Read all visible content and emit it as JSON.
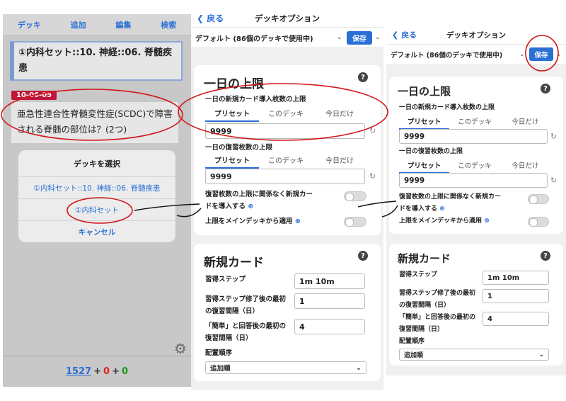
{
  "panel_review": {
    "toolbar": [
      "デッキ",
      "追加",
      "編集",
      "検索"
    ],
    "deck_name": "①内科セット::10. 神経::06. 脊髄疾患",
    "date_tag": "10-06-05",
    "question": "亜急性連合性脊髄変性症(SCDC)で障害される脊髄の部位は？(2つ)",
    "sheet_title": "デッキを選択",
    "sheet_options": [
      "①内科セット::10. 神経::06. 脊髄疾患",
      "①内科セット",
      "キャンセル"
    ],
    "counts": {
      "new": "1527",
      "plus1": "+",
      "learn": "0",
      "plus2": "+",
      "review": "0"
    },
    "settings_icon": "gear-icon"
  },
  "panel_options": {
    "back_label": "戻る",
    "title": "デッキオプション",
    "preset": "デフォルト (86個のデッキで使用中)",
    "save_label": "保存",
    "daily": {
      "heading": "一日の上限",
      "help": "?",
      "new_label": "一日の新規カード導入枚数の上限",
      "new_tabs": [
        "プリセット",
        "このデッキ",
        "今日だけ"
      ],
      "new_value": "9999",
      "review_label": "一日の復習枚数の上限",
      "review_tabs": [
        "プリセット",
        "このデッキ",
        "今日だけ"
      ],
      "review_value": "9999",
      "toggle1_label": "復習枚数の上限に関係なく新規カードを導入する",
      "toggle2_label": "上限をメインデッキから適用"
    },
    "newcards": {
      "heading": "新規カード",
      "help": "?",
      "steps_label": "習得ステップ",
      "steps_value": "1m 10m",
      "grad_label": "習得ステップ修了後の最初の復習間隔（日）",
      "grad_value": "1",
      "easy_label": "「簡単」と回答後の最初の復習間隔（日）",
      "easy_value": "4",
      "order_label": "配置順序",
      "order_value": "追加順"
    }
  },
  "colors": {
    "accent": "#2a6fd6",
    "annotation": "#d01818",
    "date_tag": "#c0163a"
  }
}
